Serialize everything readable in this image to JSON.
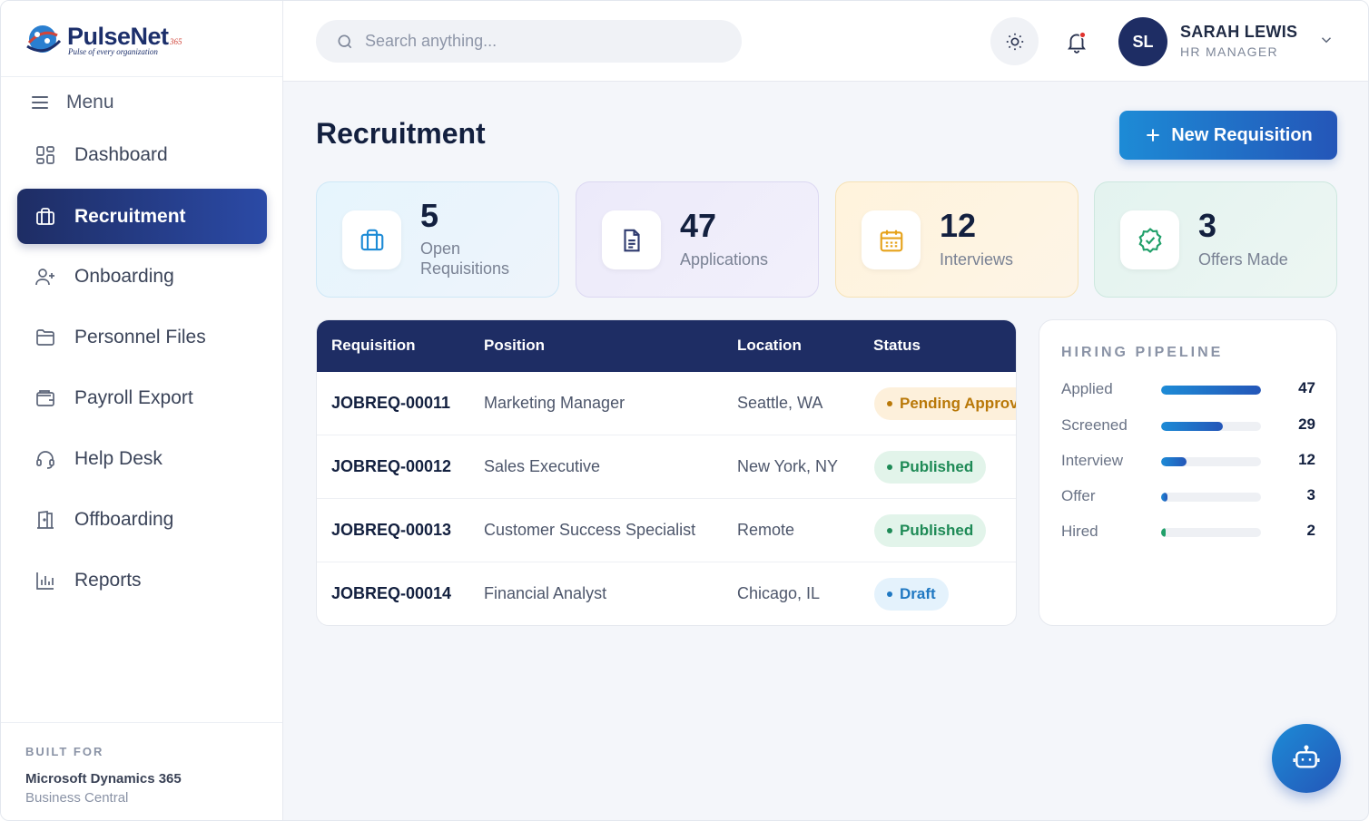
{
  "brand": {
    "name": "PulseNet",
    "suffix": "365",
    "tagline": "Pulse of every organization"
  },
  "sidebar": {
    "menu_label": "Menu",
    "items": [
      {
        "label": "Dashboard",
        "icon": "grid-icon",
        "active": false
      },
      {
        "label": "Recruitment",
        "icon": "briefcase-icon",
        "active": true
      },
      {
        "label": "Onboarding",
        "icon": "user-plus-icon",
        "active": false
      },
      {
        "label": "Personnel Files",
        "icon": "folder-icon",
        "active": false
      },
      {
        "label": "Payroll Export",
        "icon": "wallet-icon",
        "active": false
      },
      {
        "label": "Help Desk",
        "icon": "headset-icon",
        "active": false
      },
      {
        "label": "Offboarding",
        "icon": "door-icon",
        "active": false
      },
      {
        "label": "Reports",
        "icon": "bar-chart-icon",
        "active": false
      }
    ],
    "footer": {
      "caption": "BUILT FOR",
      "line1": "Microsoft Dynamics 365",
      "line2": "Business Central"
    }
  },
  "header": {
    "search_placeholder": "Search anything...",
    "user": {
      "initials": "SL",
      "name": "SARAH LEWIS",
      "role": "HR MANAGER"
    }
  },
  "page": {
    "title": "Recruitment",
    "new_button_label": "New Requisition"
  },
  "stats": [
    {
      "value": "5",
      "label": "Open Requisitions",
      "icon": "briefcase-icon"
    },
    {
      "value": "47",
      "label": "Applications",
      "icon": "document-icon"
    },
    {
      "value": "12",
      "label": "Interviews",
      "icon": "calendar-icon"
    },
    {
      "value": "3",
      "label": "Offers Made",
      "icon": "badge-check-icon"
    }
  ],
  "table": {
    "columns": [
      "Requisition",
      "Position",
      "Location",
      "Status"
    ],
    "rows": [
      {
        "req": "JOBREQ-00011",
        "position": "Marketing Manager",
        "location": "Seattle, WA",
        "status": "Pending Approval",
        "status_type": "pending"
      },
      {
        "req": "JOBREQ-00012",
        "position": "Sales Executive",
        "location": "New York, NY",
        "status": "Published",
        "status_type": "published"
      },
      {
        "req": "JOBREQ-00013",
        "position": "Customer Success Specialist",
        "location": "Remote",
        "status": "Published",
        "status_type": "published"
      },
      {
        "req": "JOBREQ-00014",
        "position": "Financial Analyst",
        "location": "Chicago, IL",
        "status": "Draft",
        "status_type": "draft"
      }
    ]
  },
  "pipeline": {
    "title": "HIRING PIPELINE",
    "stages": [
      {
        "label": "Applied",
        "value": "47",
        "fraction": 1.0
      },
      {
        "label": "Screened",
        "value": "29",
        "fraction": 0.617
      },
      {
        "label": "Interview",
        "value": "12",
        "fraction": 0.255
      },
      {
        "label": "Offer",
        "value": "3",
        "fraction": 0.064
      },
      {
        "label": "Hired",
        "value": "2",
        "fraction": 0.043
      }
    ]
  },
  "colors": {
    "navy": "#1e2d64",
    "accent_blue": "#1d8bd6",
    "pending": "#b97808",
    "published": "#1e8a56",
    "draft": "#1f78c2"
  }
}
